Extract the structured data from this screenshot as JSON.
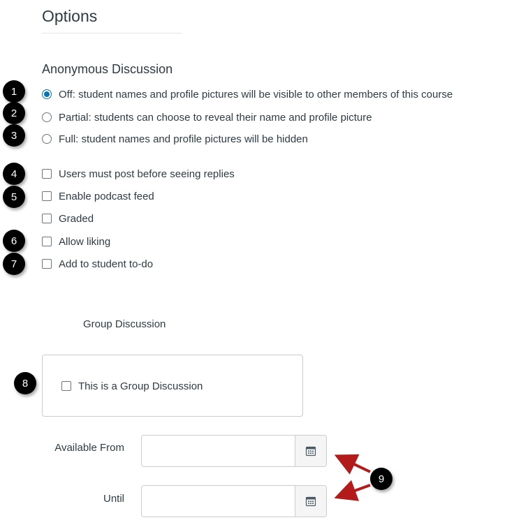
{
  "page": {
    "title": "Options",
    "anonymous_heading": "Anonymous Discussion",
    "anonymous_options": [
      {
        "label": "Off: student names and profile pictures will be visible to other members of this course",
        "checked": true
      },
      {
        "label": "Partial: students can choose to reveal their name and profile picture",
        "checked": false
      },
      {
        "label": "Full: student names and profile pictures will be hidden",
        "checked": false
      }
    ],
    "checkbox_options": [
      {
        "label": "Users must post before seeing replies",
        "checked": false
      },
      {
        "label": "Enable podcast feed",
        "checked": false
      },
      {
        "label": "Graded",
        "checked": false
      },
      {
        "label": "Allow liking",
        "checked": false
      },
      {
        "label": "Add to student to-do",
        "checked": false
      }
    ],
    "group_heading": "Group Discussion",
    "group_checkbox_label": "This is a Group Discussion",
    "available_from_label": "Available From",
    "until_label": "Until",
    "available_from_value": "",
    "until_value": "",
    "calendar_icon": "calendar-icon"
  },
  "callouts": [
    "1",
    "2",
    "3",
    "4",
    "5",
    "6",
    "7",
    "8",
    "9"
  ],
  "colors": {
    "accent": "#0374b5",
    "text": "#2d3b45",
    "callout_bg": "#000000",
    "arrow": "#b31b1b"
  }
}
